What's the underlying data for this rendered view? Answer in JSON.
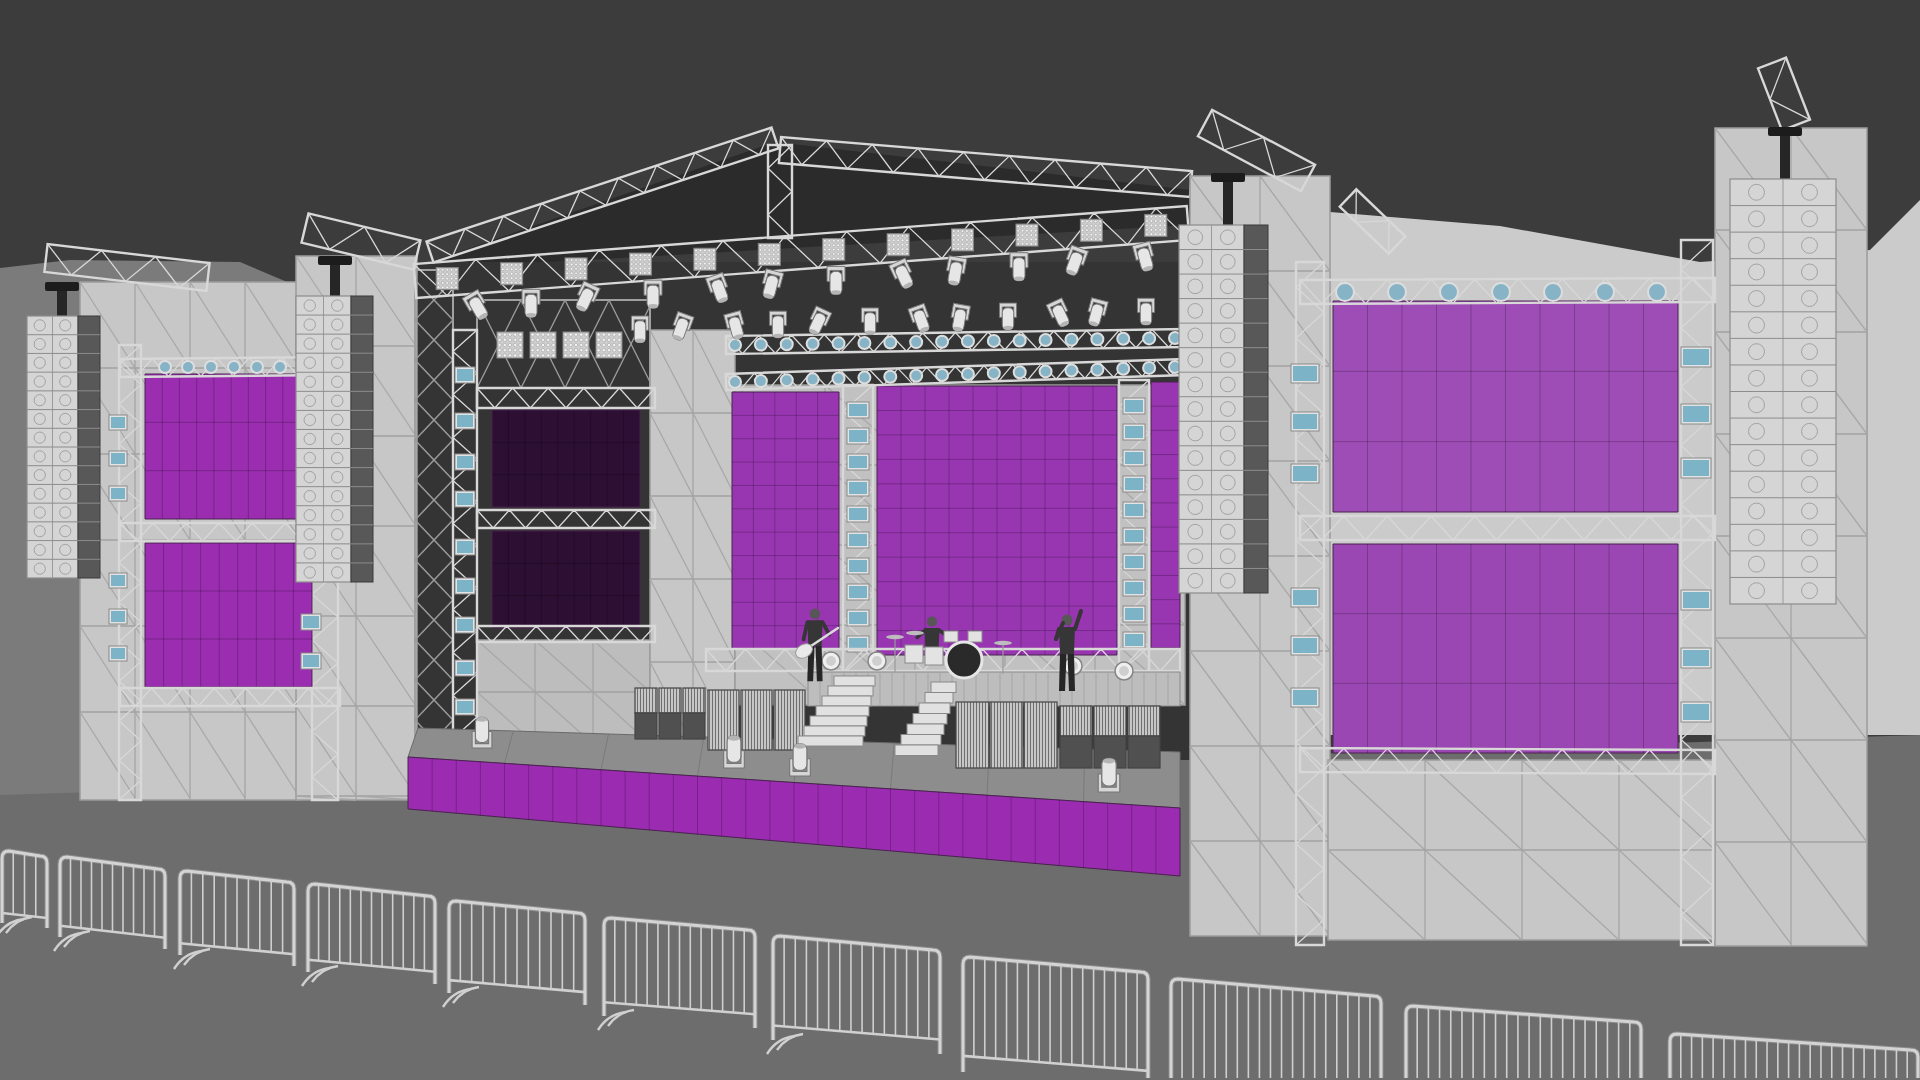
{
  "led_screens": [
    {
      "color": "#9a2db0"
    },
    {
      "color": "#9a2db0"
    },
    {
      "color": "#2d0f33"
    },
    {
      "color": "#2d0f33"
    },
    {
      "color": "#9836b1"
    },
    {
      "color": "#9836b1"
    },
    {
      "color": "#9836b1"
    },
    {
      "color": "#9d4db5"
    },
    {
      "color": "#9b47b3"
    },
    {
      "color": "#9b2bb1"
    }
  ]
}
